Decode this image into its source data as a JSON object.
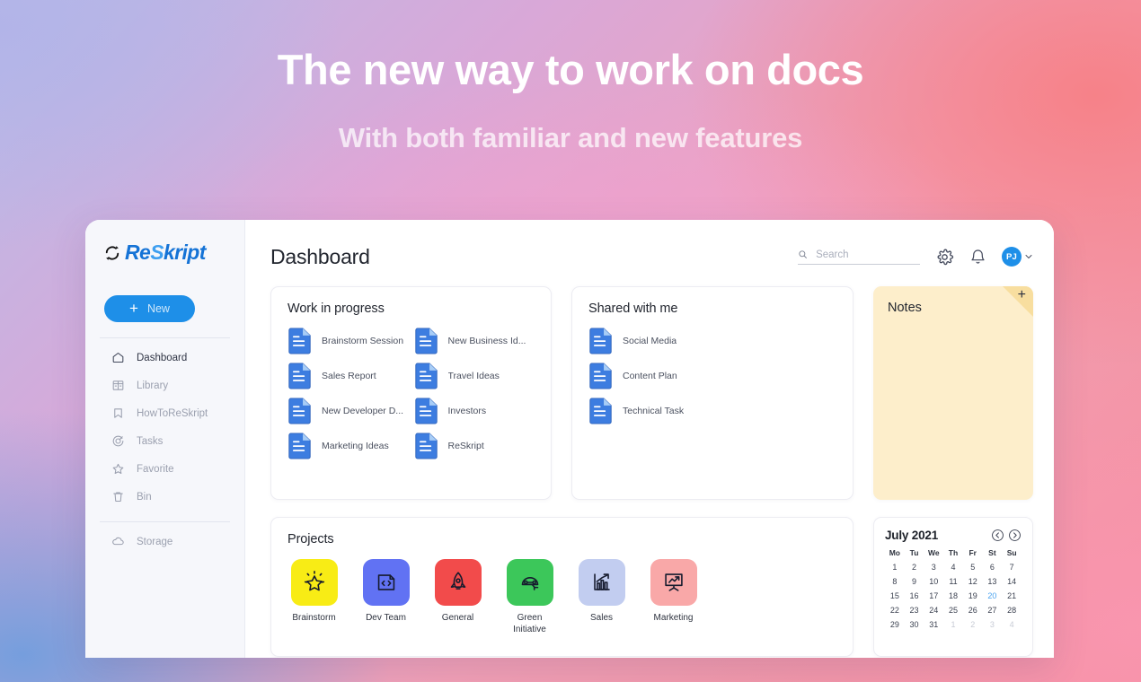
{
  "hero": {
    "title": "The new way to work on docs",
    "subtitle": "With both familiar and new features"
  },
  "colors": {
    "brand_blue": "#1e8fe8",
    "logo_dark": "#1573d6",
    "logo_light": "#3e9ff0",
    "notes_bg": "#fdeecb",
    "notes_fold": "#f8de9f",
    "today_blue": "#4ba3ef"
  },
  "sidebar": {
    "logo": {
      "icon": "refresh-cycle-icon",
      "part1": "Re",
      "part2": "S",
      "part3": "kript"
    },
    "new_button": {
      "plus": "+",
      "label": "New"
    },
    "items": [
      {
        "label": "Dashboard",
        "icon": "home-icon",
        "active": true
      },
      {
        "label": "Library",
        "icon": "library-icon",
        "active": false
      },
      {
        "label": "HowToReSkript",
        "icon": "bookmark-icon",
        "active": false
      },
      {
        "label": "Tasks",
        "icon": "target-icon",
        "active": false
      },
      {
        "label": "Favorite",
        "icon": "star-icon",
        "active": false
      },
      {
        "label": "Bin",
        "icon": "trash-icon",
        "active": false
      }
    ],
    "storage": {
      "label": "Storage",
      "icon": "cloud-icon"
    }
  },
  "header": {
    "title": "Dashboard",
    "search_placeholder": "Search",
    "search_value": "",
    "search_icon": "search-icon",
    "settings_icon": "gear-icon",
    "notifications_icon": "bell-icon",
    "avatar_initials": "PJ",
    "avatar_caret": "chevron-down-icon"
  },
  "work_in_progress": {
    "title": "Work in progress",
    "column_left": [
      "Brainstorm Session",
      "Sales Report",
      "New Developer D...",
      "Marketing Ideas"
    ],
    "column_right": [
      "New Business Id...",
      "Travel Ideas",
      "Investors",
      "ReSkript"
    ]
  },
  "shared_with_me": {
    "title": "Shared with me",
    "items": [
      "Social Media",
      "Content Plan",
      "Technical Task"
    ]
  },
  "notes": {
    "title": "Notes",
    "add_label": "+",
    "body": ""
  },
  "projects": {
    "title": "Projects",
    "items": [
      {
        "label": "Brainstorm",
        "color": "#f8ec15",
        "icon": "sparkle-star-icon"
      },
      {
        "label": "Dev Team",
        "color": "#6172f3",
        "icon": "code-file-icon"
      },
      {
        "label": "General",
        "color": "#f24b4b",
        "icon": "rocket-icon"
      },
      {
        "label": "Green Initiative",
        "color": "#3cc75a",
        "icon": "eco-car-icon"
      },
      {
        "label": "Sales",
        "color": "#c2cdf0",
        "icon": "bar-chart-growth-icon"
      },
      {
        "label": "Marketing",
        "color": "#f9a8a8",
        "icon": "presentation-chart-icon"
      }
    ]
  },
  "calendar": {
    "month": "July 2021",
    "prev_icon": "chevron-left-circle-icon",
    "next_icon": "chevron-right-circle-icon",
    "weekdays": [
      "Mo",
      "Tu",
      "We",
      "Th",
      "Fr",
      "St",
      "Su"
    ],
    "days": [
      {
        "n": "1",
        "state": "normal"
      },
      {
        "n": "2",
        "state": "normal"
      },
      {
        "n": "3",
        "state": "normal"
      },
      {
        "n": "4",
        "state": "normal"
      },
      {
        "n": "5",
        "state": "normal"
      },
      {
        "n": "6",
        "state": "normal"
      },
      {
        "n": "7",
        "state": "normal"
      },
      {
        "n": "8",
        "state": "normal"
      },
      {
        "n": "9",
        "state": "normal"
      },
      {
        "n": "10",
        "state": "normal"
      },
      {
        "n": "11",
        "state": "normal"
      },
      {
        "n": "12",
        "state": "normal"
      },
      {
        "n": "13",
        "state": "normal"
      },
      {
        "n": "14",
        "state": "normal"
      },
      {
        "n": "15",
        "state": "normal"
      },
      {
        "n": "16",
        "state": "normal"
      },
      {
        "n": "17",
        "state": "normal"
      },
      {
        "n": "18",
        "state": "normal"
      },
      {
        "n": "19",
        "state": "normal"
      },
      {
        "n": "20",
        "state": "today"
      },
      {
        "n": "21",
        "state": "normal"
      },
      {
        "n": "22",
        "state": "normal"
      },
      {
        "n": "23",
        "state": "normal"
      },
      {
        "n": "24",
        "state": "normal"
      },
      {
        "n": "25",
        "state": "normal"
      },
      {
        "n": "26",
        "state": "normal"
      },
      {
        "n": "27",
        "state": "normal"
      },
      {
        "n": "28",
        "state": "normal"
      },
      {
        "n": "29",
        "state": "normal"
      },
      {
        "n": "30",
        "state": "normal"
      },
      {
        "n": "31",
        "state": "normal"
      },
      {
        "n": "1",
        "state": "muted"
      },
      {
        "n": "2",
        "state": "muted"
      },
      {
        "n": "3",
        "state": "muted"
      },
      {
        "n": "4",
        "state": "muted"
      }
    ]
  }
}
